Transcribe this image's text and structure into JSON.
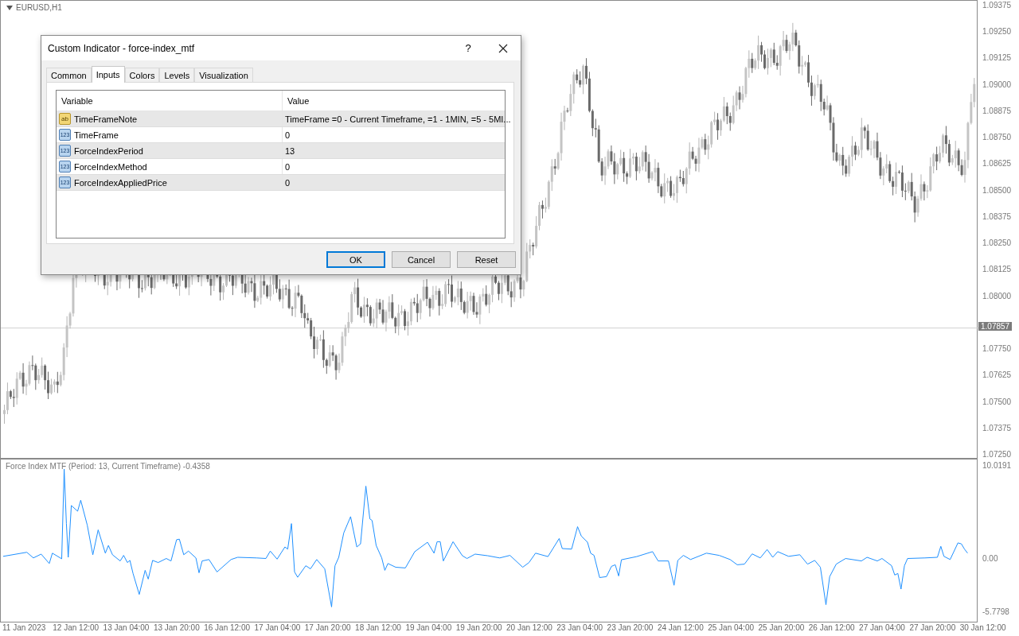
{
  "chart": {
    "title": "EURUSD,H1",
    "price_axis": [
      "1.09375",
      "1.09250",
      "1.09125",
      "1.09000",
      "1.08875",
      "1.08750",
      "1.08625",
      "1.08500",
      "1.08375",
      "1.08250",
      "1.08125",
      "1.08000",
      "1.07750",
      "1.07625",
      "1.07500",
      "1.07375",
      "1.07250"
    ],
    "current_price": "1.07857"
  },
  "indicator": {
    "label": "Force Index MTF (Period: 13, Current Timeframe) -0.4358",
    "value_axis": [
      "10.0191",
      "0.00",
      "-5.7798"
    ],
    "time_axis": [
      "11 Jan 2023",
      "12 Jan 12:00",
      "13 Jan 04:00",
      "13 Jan 20:00",
      "16 Jan 12:00",
      "17 Jan 04:00",
      "17 Jan 20:00",
      "18 Jan 12:00",
      "19 Jan 04:00",
      "19 Jan 20:00",
      "20 Jan 12:00",
      "23 Jan 04:00",
      "23 Jan 20:00",
      "24 Jan 12:00",
      "25 Jan 04:00",
      "25 Jan 20:00",
      "26 Jan 12:00",
      "27 Jan 04:00",
      "27 Jan 20:00",
      "30 Jan 12:00"
    ]
  },
  "dialog": {
    "title": "Custom Indicator - force-index_mtf",
    "help": "?",
    "tabs": [
      {
        "label": "Common",
        "selected": false
      },
      {
        "label": "Inputs",
        "selected": true
      },
      {
        "label": "Colors",
        "selected": false
      },
      {
        "label": "Levels",
        "selected": false
      },
      {
        "label": "Visualization",
        "selected": false
      }
    ],
    "table": {
      "columns": [
        "Variable",
        "Value"
      ],
      "rows": [
        {
          "kind": "string",
          "icon": "ab",
          "variable": "TimeFrameNote",
          "value": "TimeFrame =0 - Current Timeframe, =1 - 1MIN, =5 - 5MI..."
        },
        {
          "kind": "integer",
          "icon": "123",
          "variable": "TimeFrame",
          "value": "0"
        },
        {
          "kind": "integer",
          "icon": "123",
          "variable": "ForceIndexPeriod",
          "value": "13"
        },
        {
          "kind": "integer",
          "icon": "123",
          "variable": "ForceIndexMethod",
          "value": "0"
        },
        {
          "kind": "integer",
          "icon": "123",
          "variable": "ForceIndexAppliedPrice",
          "value": "0"
        }
      ]
    },
    "buttons": [
      {
        "label": "OK",
        "default": true
      },
      {
        "label": "Cancel",
        "default": false
      },
      {
        "label": "Reset",
        "default": false
      }
    ]
  }
}
